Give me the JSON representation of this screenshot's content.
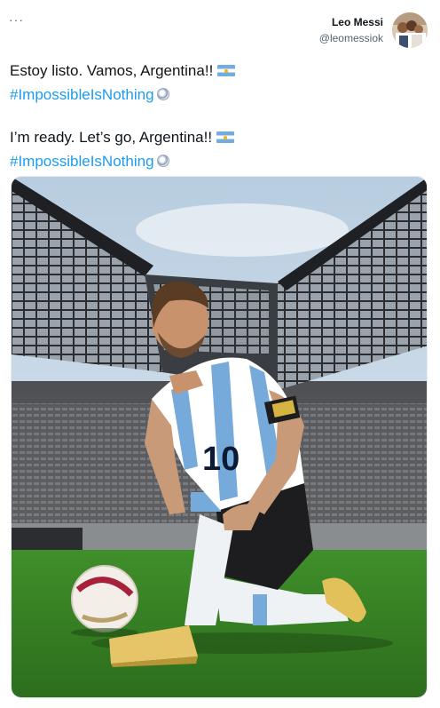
{
  "header": {
    "more_label": "···",
    "author_name": "Leo Messi",
    "author_handle": "@leomessiok"
  },
  "tweet": {
    "paragraphs": [
      {
        "text": "Estoy listo. Vamos, Argentina!!",
        "flag": "argentina-flag-icon",
        "hashtag": "#ImpossibleIsNothing",
        "hashtag_emoji": "soccer-ball-icon"
      },
      {
        "text": "I’m ready. Let’s go, Argentina!!",
        "flag": "argentina-flag-icon",
        "hashtag": "#ImpossibleIsNothing",
        "hashtag_emoji": "soccer-ball-icon"
      }
    ]
  },
  "photo": {
    "jersey_number": "10"
  },
  "colors": {
    "hashtag": "#1d9bf0",
    "text": "#0f1419",
    "secondary": "#536471",
    "flag_blue": "#74acdf"
  }
}
